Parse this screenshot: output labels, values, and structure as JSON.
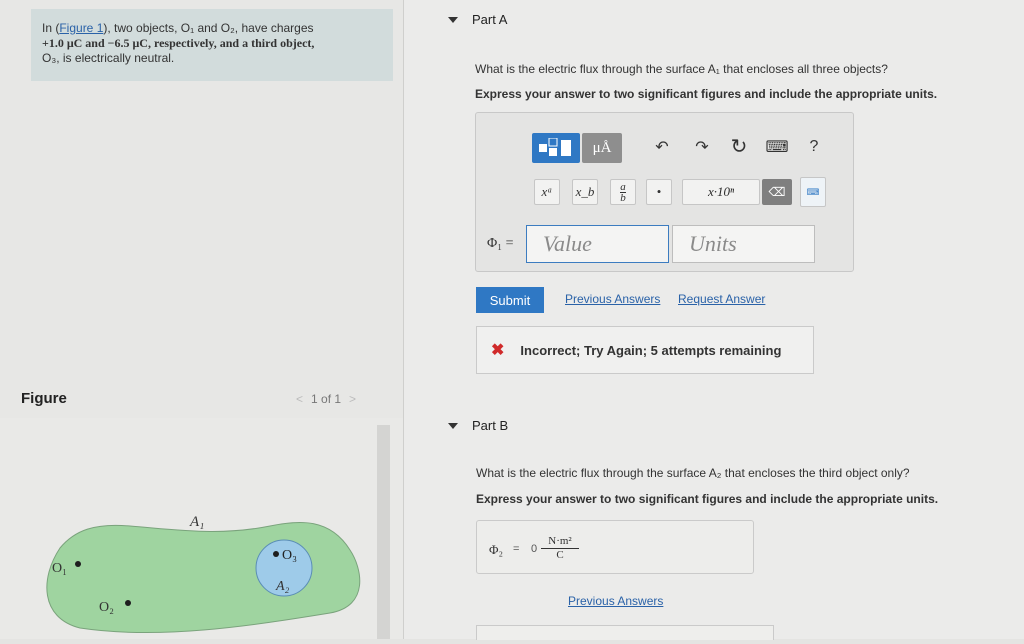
{
  "intro": {
    "prefix": "In (",
    "figure_link": "Figure 1",
    "line1_rest": "), two objects, O₁ and O₂, have charges",
    "line2": "+1.0 μC and −6.5 μC, respectively, and a third object,",
    "line3": "O₃, is electrically neutral."
  },
  "figure": {
    "label": "Figure",
    "pager": "1 of 1",
    "prev_arrow": "<",
    "next_arrow": ">",
    "labels": {
      "a1": "A₁",
      "a2": "A₂",
      "o1": "O₁",
      "o2": "O₂",
      "o3": "O₃"
    },
    "colors": {
      "surface_a1": "#9fd4a0",
      "surface_a2": "#9ecbe9"
    }
  },
  "partA": {
    "header": "Part A",
    "question": "What is the electric flux through the surface A₁ that encloses all three objects?",
    "instruction": "Express your answer to two significant figures and include the appropriate units.",
    "toolbar": {
      "template_icon": "template-icon",
      "units_label": "μÅ",
      "undo_icon": "↶",
      "redo_icon": "↷",
      "reset_icon": "↻",
      "keyboard_icon": "⌨",
      "help_label": "?",
      "superscript": "xᵃ",
      "subscript": "x_b",
      "fraction_num": "a",
      "fraction_den": "b",
      "dot": "•",
      "sci": "x·10ⁿ",
      "delete": "⌫",
      "keyboard_toggle": "⌨"
    },
    "phi_label": "Φ₁ =",
    "value_placeholder": "Value",
    "units_placeholder": "Units",
    "submit": "Submit",
    "previous_answers": "Previous Answers",
    "request_answer": "Request Answer",
    "feedback": "Incorrect; Try Again; 5 attempts remaining",
    "feedback_icon": "✖"
  },
  "partB": {
    "header": "Part B",
    "question": "What is the electric flux through the surface A₂ that encloses the third object only?",
    "instruction": "Express your answer to two significant figures and include the appropriate units.",
    "phi_label": "Φ₂",
    "equals": "=",
    "value": "0",
    "units_num": "N·m²",
    "units_den": "C",
    "previous_answers": "Previous Answers"
  }
}
